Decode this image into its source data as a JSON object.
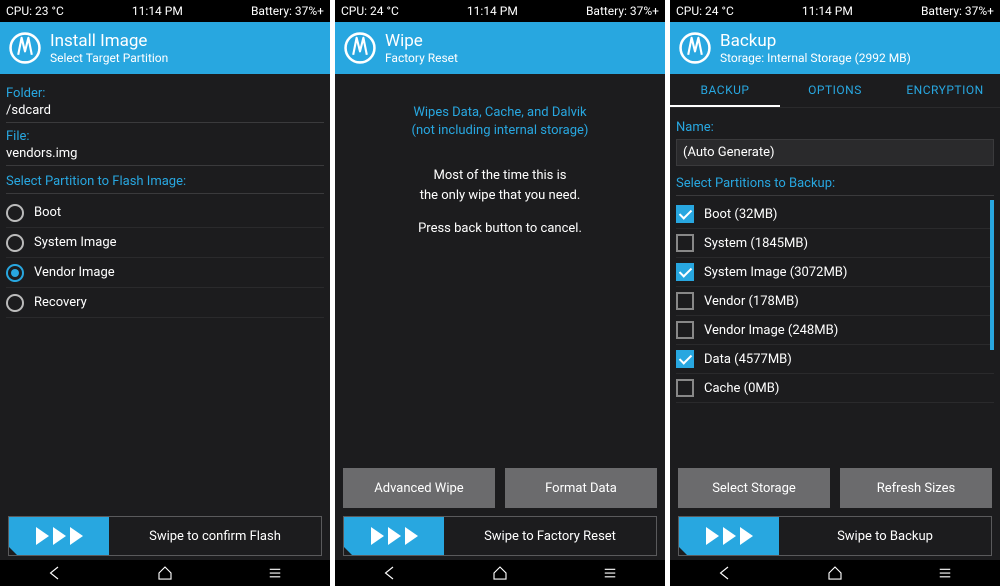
{
  "panes": [
    {
      "status": {
        "cpu": "CPU: 23 °C",
        "time": "11:14 PM",
        "battery": "Battery: 37%+"
      },
      "header": {
        "title": "Install Image",
        "subtitle": "Select Target Partition"
      },
      "folder_label": "Folder:",
      "folder_value": "/sdcard",
      "file_label": "File:",
      "file_value": "vendors.img",
      "section": "Select Partition to Flash Image:",
      "partitions": [
        {
          "label": "Boot",
          "checked": false
        },
        {
          "label": "System Image",
          "checked": false
        },
        {
          "label": "Vendor Image",
          "checked": true
        },
        {
          "label": "Recovery",
          "checked": false
        }
      ],
      "swipe": "Swipe to confirm Flash"
    },
    {
      "status": {
        "cpu": "CPU: 24 °C",
        "time": "11:14 PM",
        "battery": "Battery: 37%+"
      },
      "header": {
        "title": "Wipe",
        "subtitle": "Factory Reset"
      },
      "blue_line1": "Wipes Data, Cache, and Dalvik",
      "blue_line2": "(not including internal storage)",
      "white_line1": "Most of the time this is",
      "white_line2": "the only wipe that you need.",
      "white_line3": "Press back button to cancel.",
      "btn1": "Advanced Wipe",
      "btn2": "Format Data",
      "swipe": "Swipe to Factory Reset"
    },
    {
      "status": {
        "cpu": "CPU: 24 °C",
        "time": "11:14 PM",
        "battery": "Battery: 37%+"
      },
      "header": {
        "title": "Backup",
        "subtitle": "Storage: Internal Storage (2992 MB)"
      },
      "tabs": [
        "BACKUP",
        "OPTIONS",
        "ENCRYPTION"
      ],
      "active_tab": 0,
      "name_label": "Name:",
      "name_value": "(Auto Generate)",
      "section": "Select Partitions to Backup:",
      "partitions": [
        {
          "label": "Boot (32MB)",
          "checked": true
        },
        {
          "label": "System (1845MB)",
          "checked": false
        },
        {
          "label": "System Image (3072MB)",
          "checked": true
        },
        {
          "label": "Vendor (178MB)",
          "checked": false
        },
        {
          "label": "Vendor Image (248MB)",
          "checked": false
        },
        {
          "label": "Data (4577MB)",
          "checked": true
        },
        {
          "label": "Cache (0MB)",
          "checked": false
        }
      ],
      "btn1": "Select Storage",
      "btn2": "Refresh Sizes",
      "swipe": "Swipe to Backup"
    }
  ]
}
